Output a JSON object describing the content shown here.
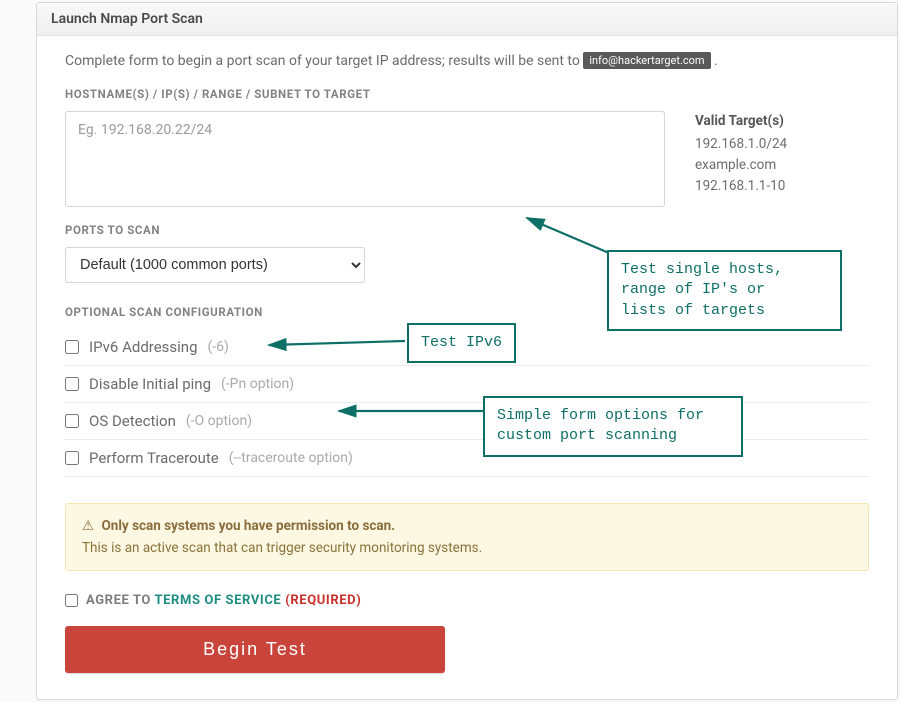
{
  "header": {
    "title": "Launch Nmap Port Scan"
  },
  "intro": {
    "text_before": "Complete form to begin a port scan of your target IP address; results will be sent to ",
    "email_badge": "info@hackertarget.com",
    "text_after": "."
  },
  "target": {
    "label": "HOSTNAME(S) / IP(S) / RANGE / SUBNET TO TARGET",
    "placeholder": "Eg. 192.168.20.22/24",
    "value": ""
  },
  "valid_targets": {
    "heading": "Valid Target(s)",
    "items": [
      "192.168.1.0/24",
      "example.com",
      "192.168.1.1-10"
    ]
  },
  "ports": {
    "label": "PORTS TO SCAN",
    "selected": "Default (1000 common ports)"
  },
  "optional": {
    "label": "OPTIONAL SCAN CONFIGURATION",
    "items": [
      {
        "name": "opt-ipv6",
        "label": "IPv6 Addressing",
        "note": "(-6)"
      },
      {
        "name": "opt-pn",
        "label": "Disable Initial ping",
        "note": "(-Pn option)"
      },
      {
        "name": "opt-os",
        "label": "OS Detection",
        "note": "(-O option)"
      },
      {
        "name": "opt-trace",
        "label": "Perform Traceroute",
        "note": "(--traceroute option)"
      }
    ]
  },
  "alert": {
    "heading": "Only scan systems you have permission to scan.",
    "body": "This is an active scan that can trigger security monitoring systems."
  },
  "agree": {
    "prefix": "AGREE TO ",
    "link": "TERMS OF SERVICE",
    "required": "(REQUIRED)"
  },
  "submit": {
    "label": "Begin Test"
  },
  "callouts": {
    "targets": "Test single hosts,\nrange of IP's or\nlists of targets",
    "ipv6": "Test IPv6",
    "options": "Simple form options for\ncustom port scanning"
  },
  "colors": {
    "teal": "#0e6f66",
    "red": "#c9453c",
    "warn_bg": "#fcf8e3"
  }
}
